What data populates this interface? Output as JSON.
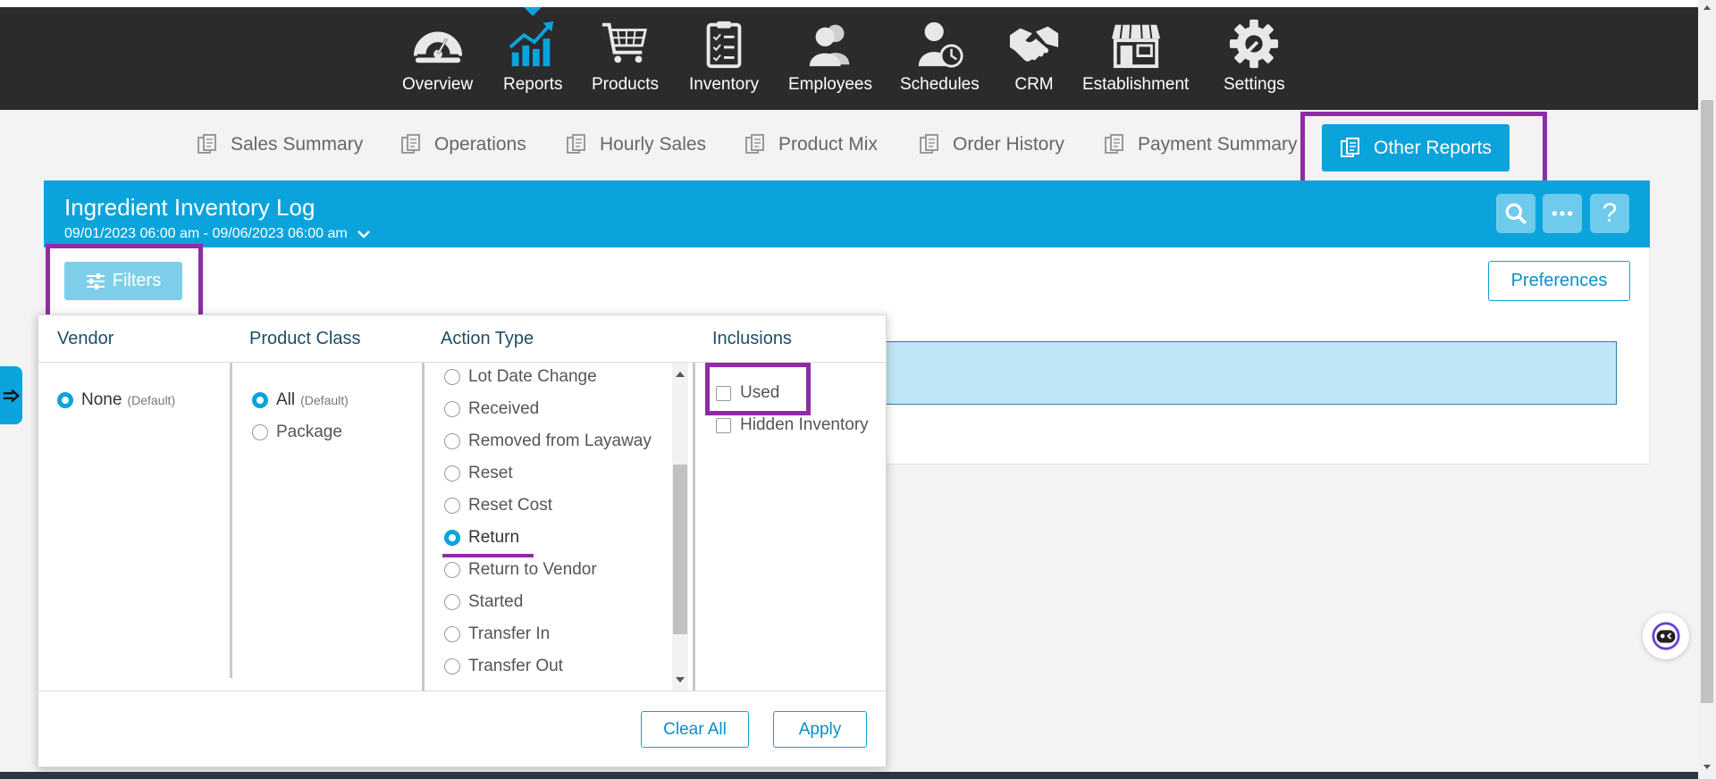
{
  "nav": {
    "items": [
      {
        "label": "Overview",
        "icon": "gauge-icon"
      },
      {
        "label": "Reports",
        "icon": "chart-trend-icon"
      },
      {
        "label": "Products",
        "icon": "cart-icon"
      },
      {
        "label": "Inventory",
        "icon": "clipboard-icon"
      },
      {
        "label": "Employees",
        "icon": "people-icon"
      },
      {
        "label": "Schedules",
        "icon": "person-clock-icon"
      },
      {
        "label": "CRM",
        "icon": "handshake-icon"
      },
      {
        "label": "Establishment",
        "icon": "storefront-icon"
      },
      {
        "label": "Settings",
        "icon": "gear-icon"
      }
    ],
    "active": "Reports"
  },
  "subtabs": [
    {
      "label": "Sales Summary"
    },
    {
      "label": "Operations"
    },
    {
      "label": "Hourly Sales"
    },
    {
      "label": "Product Mix"
    },
    {
      "label": "Order History"
    },
    {
      "label": "Payment Summary"
    },
    {
      "label": "Other Reports",
      "active": true
    }
  ],
  "report": {
    "title": "Ingredient Inventory Log",
    "date_range": "09/01/2023 06:00 am - 09/06/2023 06:00 am"
  },
  "toolbar": {
    "filters_label": "Filters",
    "preferences_label": "Preferences",
    "help_label": "?"
  },
  "filters": {
    "vendor": {
      "heading": "Vendor",
      "options": [
        {
          "label": "None",
          "note": "(Default)",
          "selected": true
        }
      ]
    },
    "product_class": {
      "heading": "Product Class",
      "options": [
        {
          "label": "All",
          "note": "(Default)",
          "selected": true
        },
        {
          "label": "Package",
          "selected": false
        }
      ]
    },
    "action_type": {
      "heading": "Action Type",
      "options": [
        {
          "label": "Lot Date Change",
          "selected": false
        },
        {
          "label": "Received",
          "selected": false
        },
        {
          "label": "Removed from Layaway",
          "selected": false
        },
        {
          "label": "Reset",
          "selected": false
        },
        {
          "label": "Reset Cost",
          "selected": false
        },
        {
          "label": "Return",
          "selected": true
        },
        {
          "label": "Return to Vendor",
          "selected": false
        },
        {
          "label": "Started",
          "selected": false
        },
        {
          "label": "Transfer In",
          "selected": false
        },
        {
          "label": "Transfer Out",
          "selected": false
        }
      ]
    },
    "inclusions": {
      "heading": "Inclusions",
      "options": [
        {
          "label": "Used",
          "checked": false
        },
        {
          "label": "Hidden Inventory",
          "checked": false
        }
      ]
    },
    "clear_label": "Clear All",
    "apply_label": "Apply"
  },
  "colors": {
    "accent": "#0aa3dc",
    "nav_bg": "#2b2b2b",
    "highlight": "#8e2ca6"
  }
}
